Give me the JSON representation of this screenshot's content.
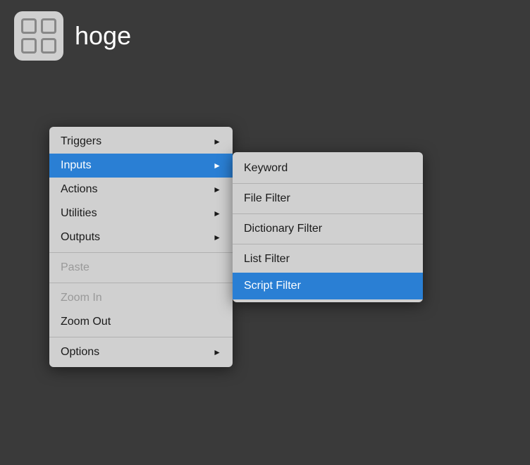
{
  "app": {
    "title": "hoge"
  },
  "primaryMenu": {
    "items": [
      {
        "id": "triggers",
        "label": "Triggers",
        "hasArrow": true,
        "disabled": false,
        "active": false
      },
      {
        "id": "inputs",
        "label": "Inputs",
        "hasArrow": true,
        "disabled": false,
        "active": true
      },
      {
        "id": "actions",
        "label": "Actions",
        "hasArrow": true,
        "disabled": false,
        "active": false
      },
      {
        "id": "utilities",
        "label": "Utilities",
        "hasArrow": true,
        "disabled": false,
        "active": false
      },
      {
        "id": "outputs",
        "label": "Outputs",
        "hasArrow": true,
        "disabled": false,
        "active": false
      },
      {
        "id": "separator1",
        "type": "separator"
      },
      {
        "id": "paste",
        "label": "Paste",
        "hasArrow": false,
        "disabled": true,
        "active": false
      },
      {
        "id": "separator2",
        "type": "separator"
      },
      {
        "id": "zoom-in",
        "label": "Zoom In",
        "hasArrow": false,
        "disabled": true,
        "active": false
      },
      {
        "id": "zoom-out",
        "label": "Zoom Out",
        "hasArrow": false,
        "disabled": false,
        "active": false
      },
      {
        "id": "separator3",
        "type": "separator"
      },
      {
        "id": "options",
        "label": "Options",
        "hasArrow": true,
        "disabled": false,
        "active": false
      }
    ]
  },
  "submenu": {
    "items": [
      {
        "id": "keyword",
        "label": "Keyword",
        "active": false
      },
      {
        "id": "separator1",
        "type": "separator"
      },
      {
        "id": "file-filter",
        "label": "File Filter",
        "active": false
      },
      {
        "id": "separator2",
        "type": "separator"
      },
      {
        "id": "dictionary-filter",
        "label": "Dictionary Filter",
        "active": false
      },
      {
        "id": "separator3",
        "type": "separator"
      },
      {
        "id": "list-filter",
        "label": "List Filter",
        "active": false
      },
      {
        "id": "script-filter",
        "label": "Script Filter",
        "active": true
      }
    ]
  },
  "colors": {
    "accent": "#2a7fd4",
    "background": "#3a3a3a",
    "menuBg": "#d0d0d0",
    "disabled": "#999999"
  }
}
